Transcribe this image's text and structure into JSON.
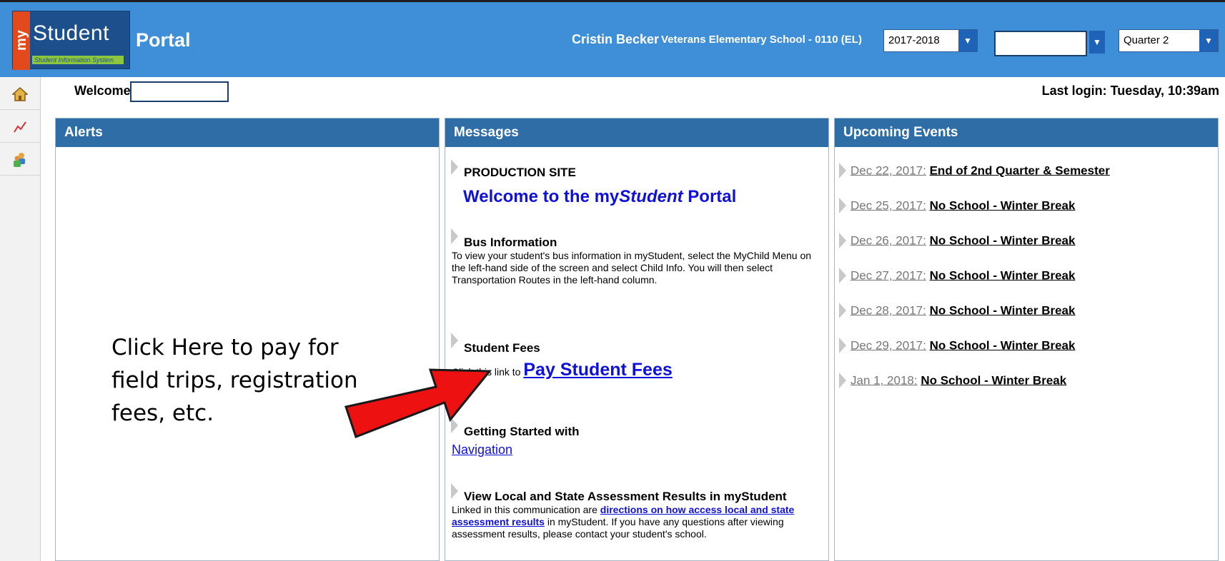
{
  "header": {
    "logo_my": "my",
    "logo_student": "Student",
    "logo_tagline": "Student Information System",
    "portal_label": "Portal",
    "user_name": "Cristin Becker",
    "school_name": "Veterans Elementary School - 0110 (EL)",
    "school_year": "2017-2018",
    "term_value": "",
    "quarter": "Quarter 2"
  },
  "rail": {
    "icons": [
      "home-icon",
      "chart-icon",
      "people-icon"
    ]
  },
  "welcome": {
    "label": "Welcome",
    "name_value": "",
    "last_login": "Last login: Tuesday, 10:39am"
  },
  "panels": {
    "alerts": "Alerts",
    "messages": "Messages",
    "events": "Upcoming Events"
  },
  "messages": {
    "production": {
      "title": "PRODUCTION SITE",
      "welcome_pre": "Welcome to the my",
      "welcome_em": "Student",
      "welcome_post": " Portal"
    },
    "bus": {
      "title": "Bus Information",
      "body": "To view your student's bus information in myStudent, select the MyChild Menu on the left-hand side of the screen and select Child Info. You will then select Transportation Routes in the left-hand column."
    },
    "fees": {
      "title": "Student Fees",
      "body": "Click this link to ",
      "link": "Pay Student Fees"
    },
    "getting_started": {
      "title": "Getting Started with",
      "link": "Navigation"
    },
    "assessment": {
      "title": "View Local and State Assessment Results in myStudent",
      "body_pre": "Linked in this communication are ",
      "link": "directions on how access local and state assessment results",
      "body_post": " in myStudent. If you have any questions after viewing assessment results, please contact your student's school."
    }
  },
  "events": [
    {
      "date": "Dec 22, 2017:",
      "name": "End of 2nd Quarter & Semester"
    },
    {
      "date": "Dec 25, 2017:",
      "name": "No School - Winter Break"
    },
    {
      "date": "Dec 26, 2017:",
      "name": "No School - Winter Break"
    },
    {
      "date": "Dec 27, 2017:",
      "name": "No School - Winter Break"
    },
    {
      "date": "Dec 28, 2017:",
      "name": "No School - Winter Break"
    },
    {
      "date": "Dec 29, 2017:",
      "name": "No School - Winter Break"
    },
    {
      "date": "Jan 1, 2018:",
      "name": "No School - Winter Break"
    }
  ],
  "annotation": {
    "text": "Click Here to pay for field trips, registration fees, etc."
  },
  "colors": {
    "header": "#3f8fd8",
    "panel_head": "#2f6da7",
    "arrow": "#ee1111",
    "link": "#1010dd"
  }
}
